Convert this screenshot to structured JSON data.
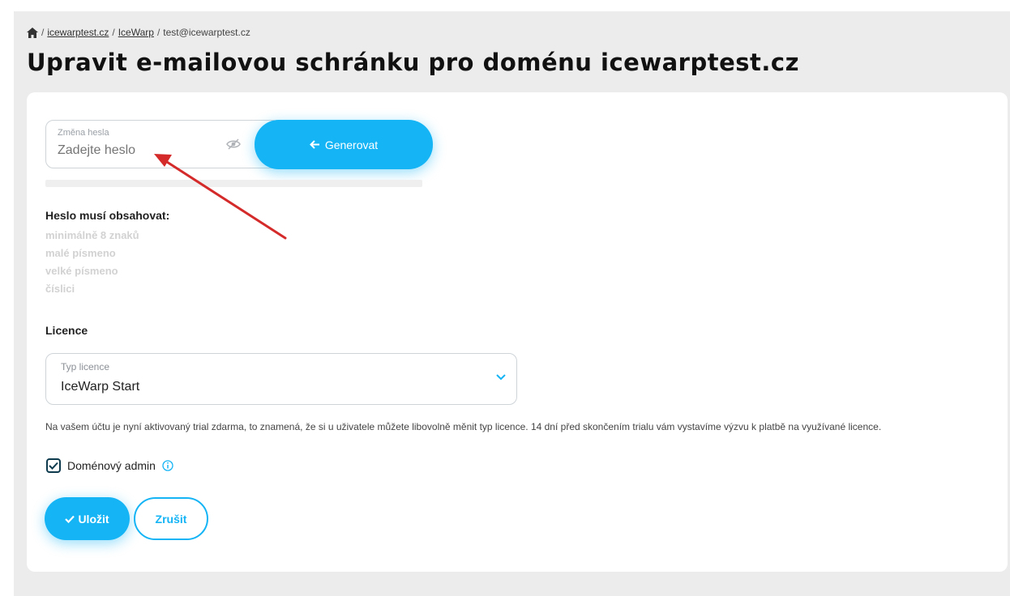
{
  "breadcrumb": {
    "icon": "home-icon",
    "items": [
      {
        "label": "icewarptest.cz",
        "link": true
      },
      {
        "label": "IceWarp",
        "link": true
      },
      {
        "label": "test@icewarptest.cz",
        "link": false
      }
    ],
    "separator": "/"
  },
  "page_title": "Upravit e-mailovou schránku pro doménu icewarptest.cz",
  "password": {
    "label": "Změna hesla",
    "placeholder": "Zadejte heslo",
    "value": "",
    "visibility_icon": "eye-off-icon",
    "generate_button": {
      "icon": "arrow-left-icon",
      "label": "Generovat"
    }
  },
  "requirements": {
    "title": "Heslo musí obsahovat:",
    "items": [
      "minimálně 8 znaků",
      "malé písmeno",
      "velké písmeno",
      "číslici"
    ]
  },
  "licence": {
    "heading": "Licence",
    "select_label": "Typ licence",
    "selected": "IceWarp Start",
    "note": "Na vašem účtu je nyní aktivovaný trial zdarma, to znamená, že si u uživatele můžete libovolně měnit typ licence. 14 dní před skončením trialu vám vystavíme výzvu k platbě na využívané licence."
  },
  "domain_admin": {
    "label": "Doménový admin",
    "checked": true,
    "icon": "info-icon"
  },
  "actions": {
    "save": {
      "icon": "checkmark-icon",
      "label": "Uložit"
    },
    "cancel": {
      "label": "Zrušit"
    }
  },
  "colors": {
    "accent": "#14b4f5",
    "background": "#ececec",
    "annotation_arrow": "#d42a2a"
  }
}
